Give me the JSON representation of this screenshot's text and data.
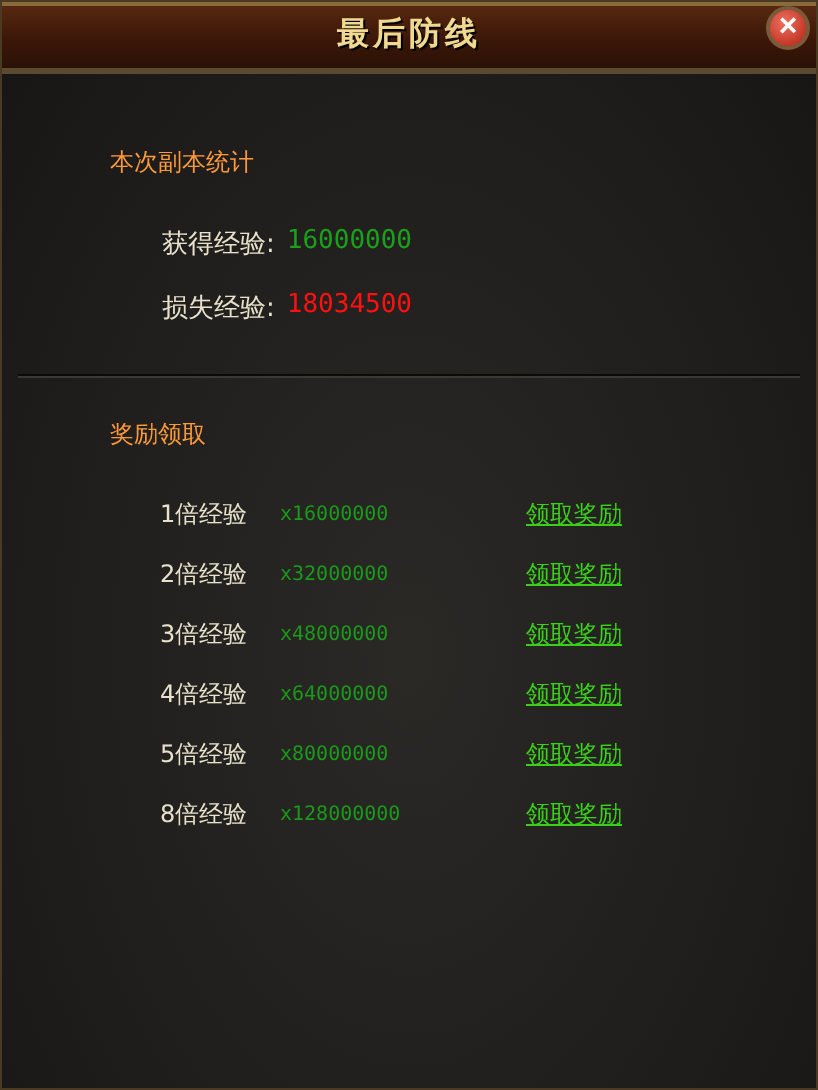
{
  "window": {
    "title": "最后防线",
    "close": "×"
  },
  "stats": {
    "heading": "本次副本统计",
    "rows": [
      {
        "kind": "gain",
        "label": "获得经验:",
        "value": "16000000"
      },
      {
        "kind": "loss",
        "label": "损失经验:",
        "value": "18034500"
      }
    ]
  },
  "rewards": {
    "heading": "奖励领取",
    "rows": [
      {
        "label": "1倍经验",
        "amount": "x16000000",
        "link": "领取奖励"
      },
      {
        "label": "2倍经验",
        "amount": "x32000000",
        "link": "领取奖励"
      },
      {
        "label": "3倍经验",
        "amount": "x48000000",
        "link": "领取奖励"
      },
      {
        "label": "4倍经验",
        "amount": "x64000000",
        "link": "领取奖励"
      },
      {
        "label": "5倍经验",
        "amount": "x80000000",
        "link": "领取奖励"
      },
      {
        "label": "8倍经验",
        "amount": "x128000000",
        "link": "领取奖励"
      }
    ]
  }
}
